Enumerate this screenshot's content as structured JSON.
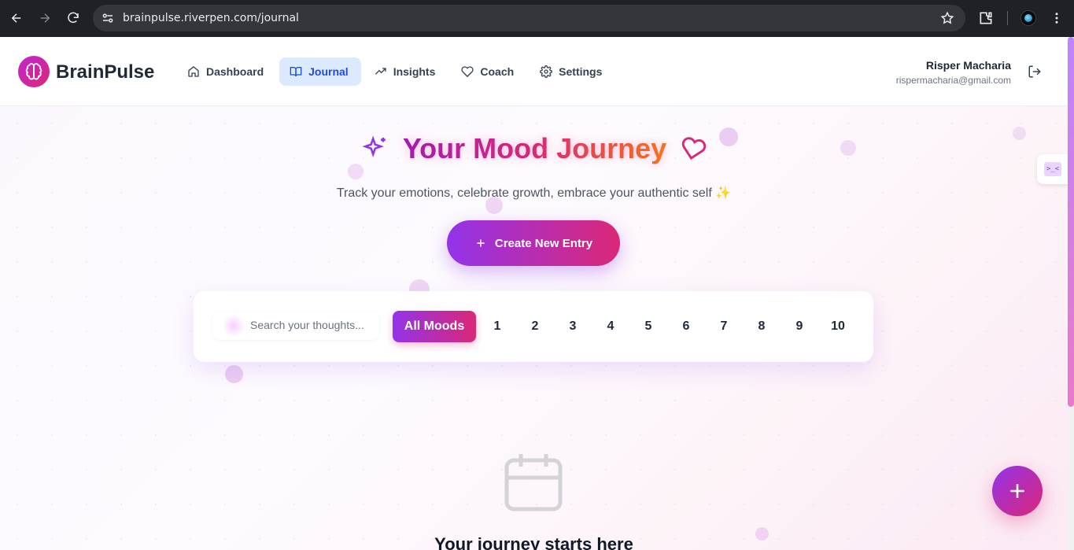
{
  "browser": {
    "url": "brainpulse.riverpen.com/journal"
  },
  "header": {
    "brand": "BrainPulse",
    "nav": [
      {
        "label": "Dashboard",
        "icon": "home-icon",
        "active": false
      },
      {
        "label": "Journal",
        "icon": "book-open-icon",
        "active": true
      },
      {
        "label": "Insights",
        "icon": "trending-up-icon",
        "active": false
      },
      {
        "label": "Coach",
        "icon": "heart-icon",
        "active": false
      },
      {
        "label": "Settings",
        "icon": "gear-icon",
        "active": false
      }
    ],
    "user": {
      "name": "Risper Macharia",
      "email": "rispermacharia@gmail.com"
    }
  },
  "hero": {
    "title": "Your Mood Journey",
    "subtitle": "Track your emotions, celebrate growth, embrace your authentic self ✨",
    "cta_label": "Create New Entry"
  },
  "filters": {
    "search_placeholder": "Search your thoughts...",
    "all_label": "All Moods",
    "moods": [
      "1",
      "2",
      "3",
      "4",
      "5",
      "6",
      "7",
      "8",
      "9",
      "10"
    ]
  },
  "empty_state": {
    "title": "Your journey starts here"
  },
  "colors": {
    "accent_purple": "#9333ea",
    "accent_pink": "#db2777",
    "active_nav_bg": "#dbeafe"
  }
}
